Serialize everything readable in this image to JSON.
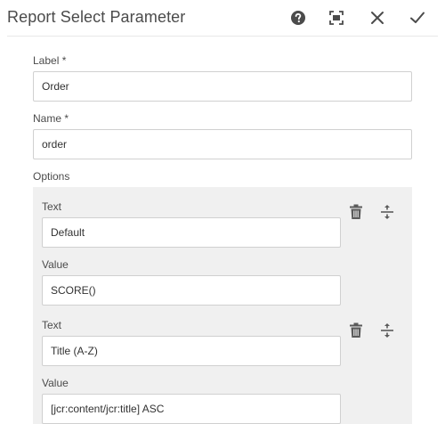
{
  "dialog": {
    "title": "Report Select Parameter",
    "actions": {
      "help": "help-icon",
      "fullscreen": "fullscreen-icon",
      "close": "close-icon",
      "done": "checkmark-icon"
    }
  },
  "form": {
    "label": {
      "label": "Label *",
      "value": "Order"
    },
    "name": {
      "label": "Name *",
      "value": "order"
    },
    "options": {
      "label": "Options",
      "items": [
        {
          "text_label": "Text",
          "text_value": "Default",
          "value_label": "Value",
          "value_value": "SCORE()"
        },
        {
          "text_label": "Text",
          "text_value": "Title (A-Z)",
          "value_label": "Value",
          "value_value": "[jcr:content/jcr:title] ASC"
        }
      ]
    }
  },
  "colors": {
    "text": "#4b4b4b",
    "border": "#d0d0d0",
    "panel": "#f0f0f0",
    "icon": "#6e6e6e"
  }
}
